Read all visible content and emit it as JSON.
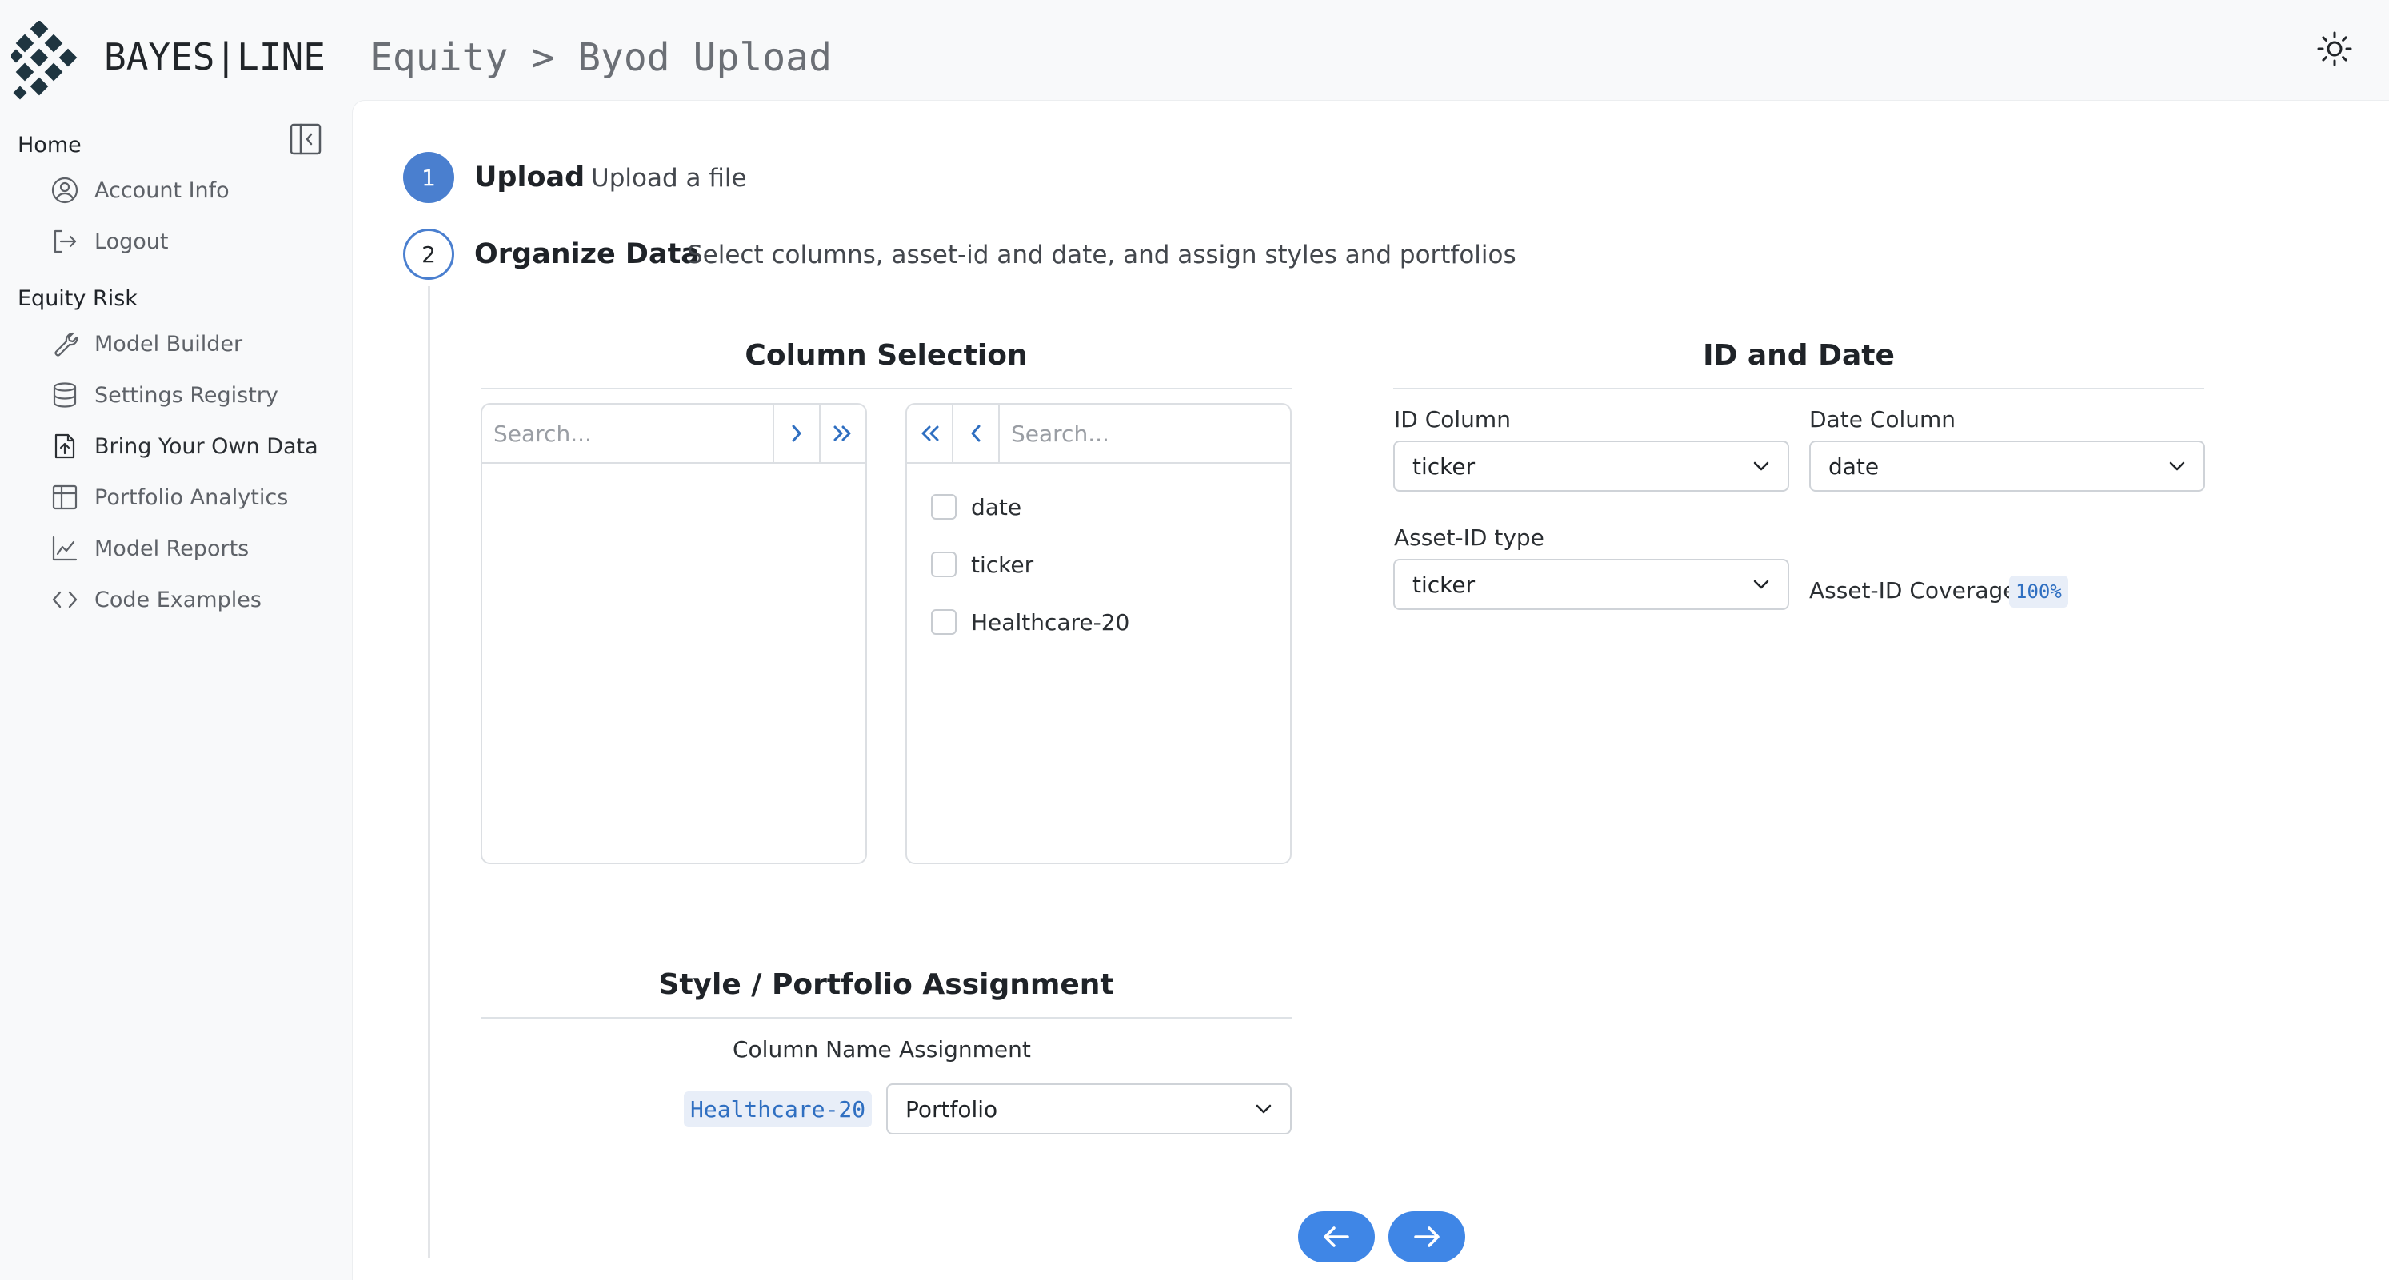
{
  "header": {
    "brand": "BAYES|LINE",
    "breadcrumb": "Equity > Byod Upload",
    "theme_icon": "sun-icon"
  },
  "sidebar": {
    "sections": [
      {
        "title": "Home",
        "items": [
          {
            "label": "Account Info",
            "icon": "user-circle-icon"
          },
          {
            "label": "Logout",
            "icon": "logout-icon"
          }
        ]
      },
      {
        "title": "Equity Risk",
        "items": [
          {
            "label": "Model Builder",
            "icon": "wrench-icon"
          },
          {
            "label": "Settings Registry",
            "icon": "database-icon"
          },
          {
            "label": "Bring Your Own Data",
            "icon": "file-upload-icon",
            "active": true
          },
          {
            "label": "Portfolio Analytics",
            "icon": "table-icon"
          },
          {
            "label": "Model Reports",
            "icon": "line-chart-icon"
          },
          {
            "label": "Code Examples",
            "icon": "code-icon"
          }
        ]
      }
    ]
  },
  "stepper": {
    "steps": [
      {
        "number": "1",
        "title": "Upload",
        "description": "Upload a file"
      },
      {
        "number": "2",
        "title": "Organize Data",
        "description": "Select columns, asset-id and date, and assign styles and portfolios"
      }
    ]
  },
  "column_selection": {
    "title": "Column Selection",
    "left_search_placeholder": "Search...",
    "right_search_placeholder": "Search...",
    "left_items": [],
    "right_items": [
      "date",
      "ticker",
      "Healthcare-20"
    ]
  },
  "id_and_date": {
    "title": "ID and Date",
    "id_column_label": "ID Column",
    "id_column_value": "ticker",
    "date_column_label": "Date Column",
    "date_column_value": "date",
    "asset_id_type_label": "Asset-ID type",
    "asset_id_type_value": "ticker",
    "coverage_label": "Asset-ID Coverage:",
    "coverage_value": "100%"
  },
  "assignment": {
    "title": "Style / Portfolio Assignment",
    "col_name_header": "Column Name",
    "assignment_header": "Assignment",
    "rows": [
      {
        "column": "Healthcare-20",
        "assignment": "Portfolio"
      }
    ]
  },
  "navigation": {
    "back_icon": "arrow-left-icon",
    "next_icon": "arrow-right-icon"
  },
  "colors": {
    "accent": "#3f86e6",
    "step_blue": "#4a7fcf",
    "logo": "#1f3540"
  }
}
